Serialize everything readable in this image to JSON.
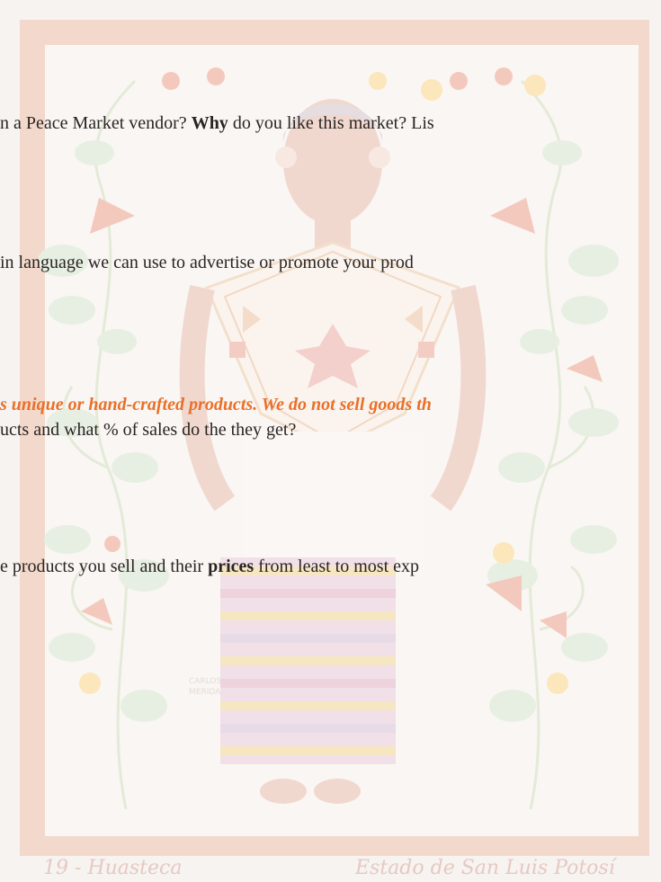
{
  "lines": {
    "q1_a": "n  a Peace Market vendor? ",
    "q1_b": "Why",
    "q1_c": " do you like this market? Lis",
    "q2": "in language we can use to advertise or promote your prod",
    "q3_notice": "s unique or hand-crafted products. We do not sell goods th",
    "q3": "ucts and what % of sales do the they get?",
    "q4_a": "e products you sell and their ",
    "q4_b": "prices",
    "q4_c": " from least to most exp"
  },
  "artwork": {
    "caption_left": "19 - Huasteca",
    "caption_right": "Estado de San Luis Potosí",
    "signature_line1": "CARLOS",
    "signature_line2": "MERIDA"
  },
  "colors": {
    "notice": "#e8702a",
    "text": "#2a2422",
    "border": "#f5dccf"
  }
}
